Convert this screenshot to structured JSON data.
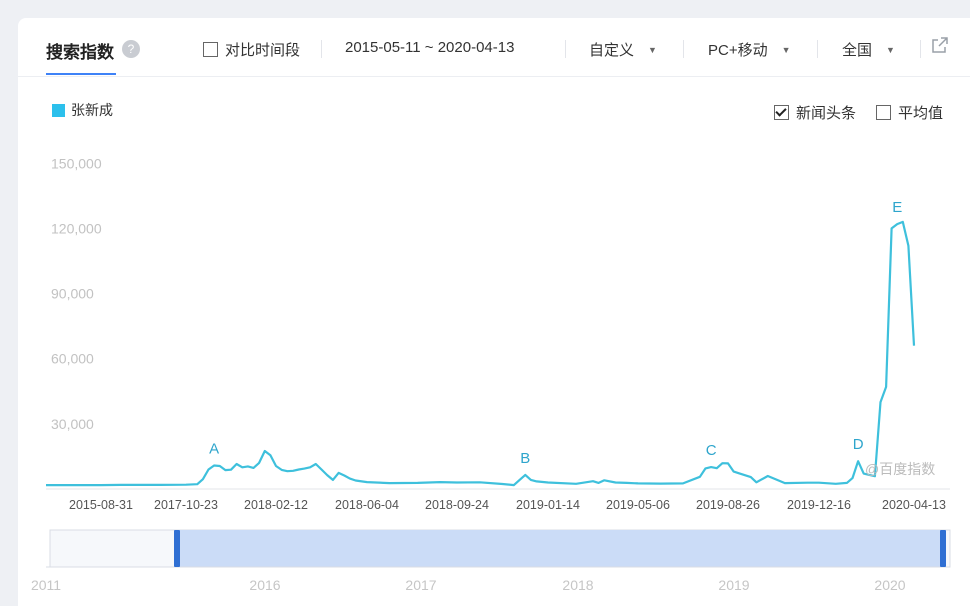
{
  "header": {
    "title": "搜索指数",
    "help_icon": "?",
    "compare_label": "对比时间段",
    "date_range": "2015-05-11 ~ 2020-04-13",
    "custom_label": "自定义",
    "device_label": "PC+移动",
    "region_label": "全国"
  },
  "legend": {
    "series_name": "张新成",
    "series_color": "#2cc0ec",
    "news_label": "新闻头条",
    "news_checked": true,
    "avg_label": "平均值",
    "avg_checked": false
  },
  "watermark": "@百度指数",
  "chart_data": {
    "type": "line",
    "series": [
      {
        "name": "张新成",
        "x": [
          "2015-05-11",
          "2015-08-31",
          "2016-03-01",
          "2017-03-01",
          "2017-10-23",
          "2017-11-06",
          "2017-11-13",
          "2017-11-20",
          "2017-11-27",
          "2017-12-04",
          "2017-12-11",
          "2017-12-18",
          "2017-12-25",
          "2018-01-01",
          "2018-01-08",
          "2018-01-15",
          "2018-01-22",
          "2018-01-29",
          "2018-02-05",
          "2018-02-12",
          "2018-02-19",
          "2018-02-26",
          "2018-03-05",
          "2018-03-12",
          "2018-03-19",
          "2018-03-26",
          "2018-04-02",
          "2018-04-09",
          "2018-04-16",
          "2018-04-23",
          "2018-04-30",
          "2018-05-07",
          "2018-05-14",
          "2018-05-21",
          "2018-06-04",
          "2018-07-02",
          "2018-08-06",
          "2018-09-03",
          "2018-09-24",
          "2018-10-22",
          "2018-11-19",
          "2018-12-03",
          "2018-12-10",
          "2018-12-17",
          "2018-12-24",
          "2018-12-31",
          "2019-01-14",
          "2019-02-18",
          "2019-03-11",
          "2019-03-18",
          "2019-03-25",
          "2019-04-08",
          "2019-04-22",
          "2019-05-06",
          "2019-06-03",
          "2019-07-01",
          "2019-07-22",
          "2019-07-29",
          "2019-08-05",
          "2019-08-12",
          "2019-08-19",
          "2019-08-26",
          "2019-09-02",
          "2019-09-09",
          "2019-09-23",
          "2019-09-30",
          "2019-10-14",
          "2019-11-04",
          "2019-12-02",
          "2019-12-16",
          "2020-01-06",
          "2020-01-20",
          "2020-01-27",
          "2020-02-03",
          "2020-02-10",
          "2020-02-17",
          "2020-02-24",
          "2020-03-02",
          "2020-03-09",
          "2020-03-16",
          "2020-03-23",
          "2020-03-30",
          "2020-04-06",
          "2020-04-13"
        ],
        "values": [
          1800,
          1800,
          1900,
          1900,
          2000,
          2200,
          4500,
          9000,
          10800,
          10600,
          8700,
          8900,
          11500,
          10000,
          10400,
          9700,
          12000,
          17500,
          15500,
          10600,
          8800,
          8200,
          8400,
          9000,
          9400,
          10000,
          11500,
          9000,
          6400,
          4200,
          7400,
          6200,
          4800,
          3900,
          3200,
          2700,
          2800,
          3200,
          3000,
          3100,
          2300,
          1800,
          4200,
          6500,
          4200,
          3500,
          3000,
          2400,
          3600,
          2800,
          4000,
          3000,
          2800,
          2600,
          2500,
          2600,
          5600,
          9500,
          10100,
          9600,
          11900,
          11800,
          8000,
          7200,
          5500,
          3100,
          6000,
          2700,
          2900,
          2900,
          2400,
          2800,
          5000,
          12800,
          7100,
          6500,
          5900,
          40000,
          47000,
          120000,
          122000,
          123000,
          112000,
          66000
        ]
      }
    ],
    "x_ticks": [
      "2015-08-31",
      "2017-10-23",
      "2018-02-12",
      "2018-06-04",
      "2018-09-24",
      "2019-01-14",
      "2019-05-06",
      "2019-08-26",
      "2019-12-16",
      "2020-04-13"
    ],
    "ylim": [
      0,
      160000
    ],
    "yticks": [
      30000,
      60000,
      90000,
      120000,
      150000
    ],
    "ytick_labels": [
      "30,000",
      "60,000",
      "90,000",
      "120,000",
      "150,000"
    ],
    "annotations": [
      {
        "label": "A",
        "x": "2017-11-27"
      },
      {
        "label": "B",
        "x": "2018-12-17"
      },
      {
        "label": "C",
        "x": "2019-08-05"
      },
      {
        "label": "D",
        "x": "2020-02-03"
      },
      {
        "label": "E",
        "x": "2020-03-23"
      }
    ],
    "slider_labels": [
      "2011",
      "2016",
      "2017",
      "2018",
      "2019",
      "2020"
    ],
    "grid": false,
    "legend_position": "top-left"
  }
}
